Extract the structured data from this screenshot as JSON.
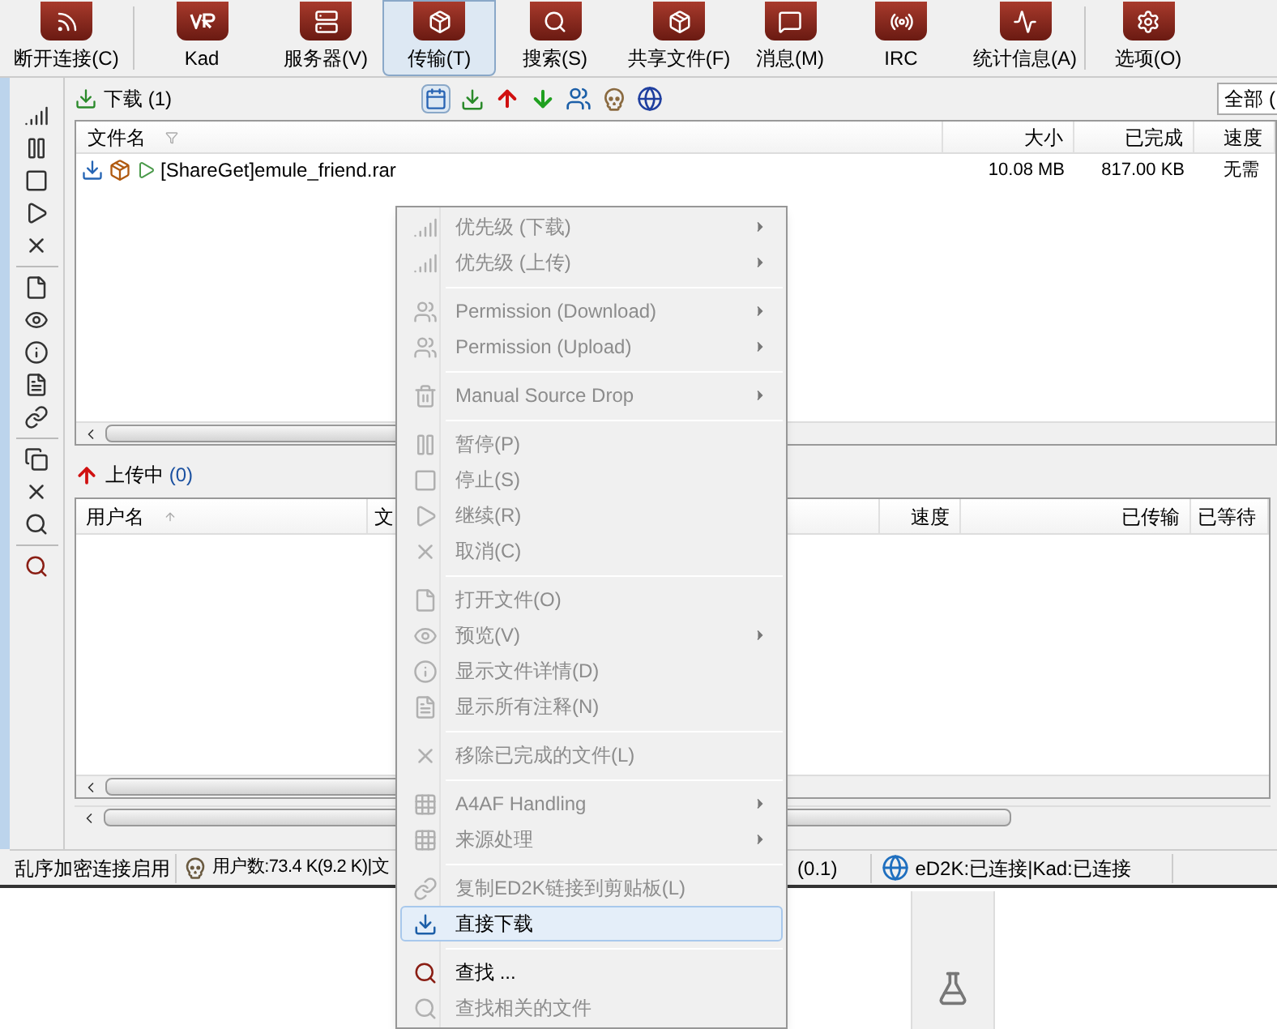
{
  "toolbar": [
    {
      "label": "断开连接(C)",
      "selected": false
    },
    {
      "label": "Kad",
      "selected": false
    },
    {
      "label": "服务器(V)",
      "selected": false
    },
    {
      "label": "传输(T)",
      "selected": true
    },
    {
      "label": "搜索(S)",
      "selected": false
    },
    {
      "label": "共享文件(F)",
      "selected": false
    },
    {
      "label": "消息(M)",
      "selected": false
    },
    {
      "label": "IRC",
      "selected": false
    },
    {
      "label": "统计信息(A)",
      "selected": false
    },
    {
      "label": "选项(O)",
      "selected": false
    }
  ],
  "downloads": {
    "title": "下载",
    "count": "(1)",
    "filter": "全部 (",
    "columns": [
      "文件名",
      "大小",
      "已完成",
      "速度"
    ],
    "rows": [
      {
        "name": "[ShareGet]emule_friend.rar",
        "size": "10.08 MB",
        "completed": "817.00 KB",
        "speed": "无需"
      }
    ]
  },
  "uploads": {
    "title": "上传中",
    "count": "(0)",
    "columns": [
      "用户名",
      "文",
      "速度",
      "已传输",
      "已等待"
    ]
  },
  "status_bar": {
    "encryption": "乱序加密连接启用",
    "users": "用户数:73.4 K(9.2 K)|文",
    "rate": "(0.1)",
    "connection": "eD2K:已连接|Kad:已连接"
  },
  "context_menu": [
    {
      "kind": "item",
      "label": "优先级 (下载)",
      "disabled": true,
      "submenu": true,
      "selected": false
    },
    {
      "kind": "item",
      "label": "优先级 (上传)",
      "disabled": true,
      "submenu": true,
      "selected": false
    },
    {
      "kind": "separator"
    },
    {
      "kind": "item",
      "label": "Permission (Download)",
      "disabled": true,
      "submenu": true,
      "selected": false
    },
    {
      "kind": "item",
      "label": "Permission (Upload)",
      "disabled": true,
      "submenu": true,
      "selected": false
    },
    {
      "kind": "separator"
    },
    {
      "kind": "item",
      "label": "Manual Source Drop",
      "disabled": true,
      "submenu": true,
      "selected": false
    },
    {
      "kind": "separator"
    },
    {
      "kind": "item",
      "label": "暂停(P)",
      "disabled": true,
      "submenu": false,
      "selected": false
    },
    {
      "kind": "item",
      "label": "停止(S)",
      "disabled": true,
      "submenu": false,
      "selected": false
    },
    {
      "kind": "item",
      "label": "继续(R)",
      "disabled": true,
      "submenu": false,
      "selected": false
    },
    {
      "kind": "item",
      "label": "取消(C)",
      "disabled": true,
      "submenu": false,
      "selected": false
    },
    {
      "kind": "separator"
    },
    {
      "kind": "item",
      "label": "打开文件(O)",
      "disabled": true,
      "submenu": false,
      "selected": false
    },
    {
      "kind": "item",
      "label": "预览(V)",
      "disabled": true,
      "submenu": true,
      "selected": false
    },
    {
      "kind": "item",
      "label": "显示文件详情(D)",
      "disabled": true,
      "submenu": false,
      "selected": false
    },
    {
      "kind": "item",
      "label": "显示所有注释(N)",
      "disabled": true,
      "submenu": false,
      "selected": false
    },
    {
      "kind": "separator"
    },
    {
      "kind": "item",
      "label": "移除已完成的文件(L)",
      "disabled": true,
      "submenu": false,
      "selected": false
    },
    {
      "kind": "separator"
    },
    {
      "kind": "item",
      "label": "A4AF Handling",
      "disabled": true,
      "submenu": true,
      "selected": false
    },
    {
      "kind": "item",
      "label": "来源处理",
      "disabled": true,
      "submenu": true,
      "selected": false
    },
    {
      "kind": "separator"
    },
    {
      "kind": "item",
      "label": "复制ED2K链接到剪贴板(L)",
      "disabled": true,
      "submenu": false,
      "selected": false
    },
    {
      "kind": "item",
      "label": "直接下载",
      "disabled": false,
      "submenu": false,
      "selected": true
    },
    {
      "kind": "separator"
    },
    {
      "kind": "item",
      "label": "查找 ...",
      "disabled": false,
      "submenu": false,
      "selected": false
    },
    {
      "kind": "item",
      "label": "查找相关的文件",
      "disabled": true,
      "submenu": false,
      "selected": false
    }
  ]
}
